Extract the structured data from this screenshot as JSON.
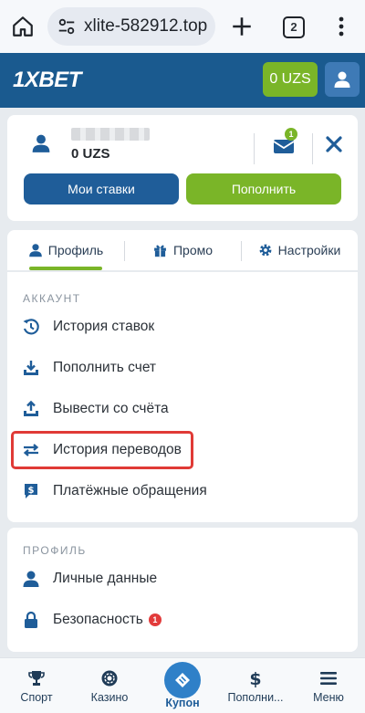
{
  "browser": {
    "url": "xlite-582912.top",
    "tab_count": "2"
  },
  "header": {
    "logo_one": "1",
    "logo_x": "X",
    "logo_bet": "BET",
    "balance": "0 UZS"
  },
  "account": {
    "balance": "0 UZS",
    "mail_badge": "1",
    "my_bets_label": "Мои ставки",
    "deposit_label": "Пополнить"
  },
  "tabs": [
    {
      "label": "Профиль"
    },
    {
      "label": "Промо"
    },
    {
      "label": "Настройки"
    }
  ],
  "account_section": {
    "title": "АККАУНТ",
    "items": [
      {
        "label": "История ставок",
        "icon": "history-icon"
      },
      {
        "label": "Пополнить счет",
        "icon": "download-icon"
      },
      {
        "label": "Вывести со счёта",
        "icon": "upload-icon"
      },
      {
        "label": "История переводов",
        "icon": "transfer-icon"
      },
      {
        "label": "Платёжные обращения",
        "icon": "payment-chat-icon"
      }
    ]
  },
  "profile_section": {
    "title": "ПРОФИЛЬ",
    "items": [
      {
        "label": "Личные данные",
        "icon": "person-icon"
      },
      {
        "label": "Безопасность",
        "icon": "lock-icon",
        "badge": "1"
      }
    ]
  },
  "bottom_nav": [
    {
      "label": "Спорт",
      "icon": "trophy-icon"
    },
    {
      "label": "Казино",
      "icon": "chip-icon"
    },
    {
      "label": "Купон",
      "icon": "coupon-icon"
    },
    {
      "label": "Пополни...",
      "icon": "dollar-icon"
    },
    {
      "label": "Меню",
      "icon": "hamburger-icon"
    }
  ],
  "colors": {
    "brand_blue": "#1a5a8f",
    "accent_green": "#7ab528",
    "highlight_red": "#e03a36"
  }
}
